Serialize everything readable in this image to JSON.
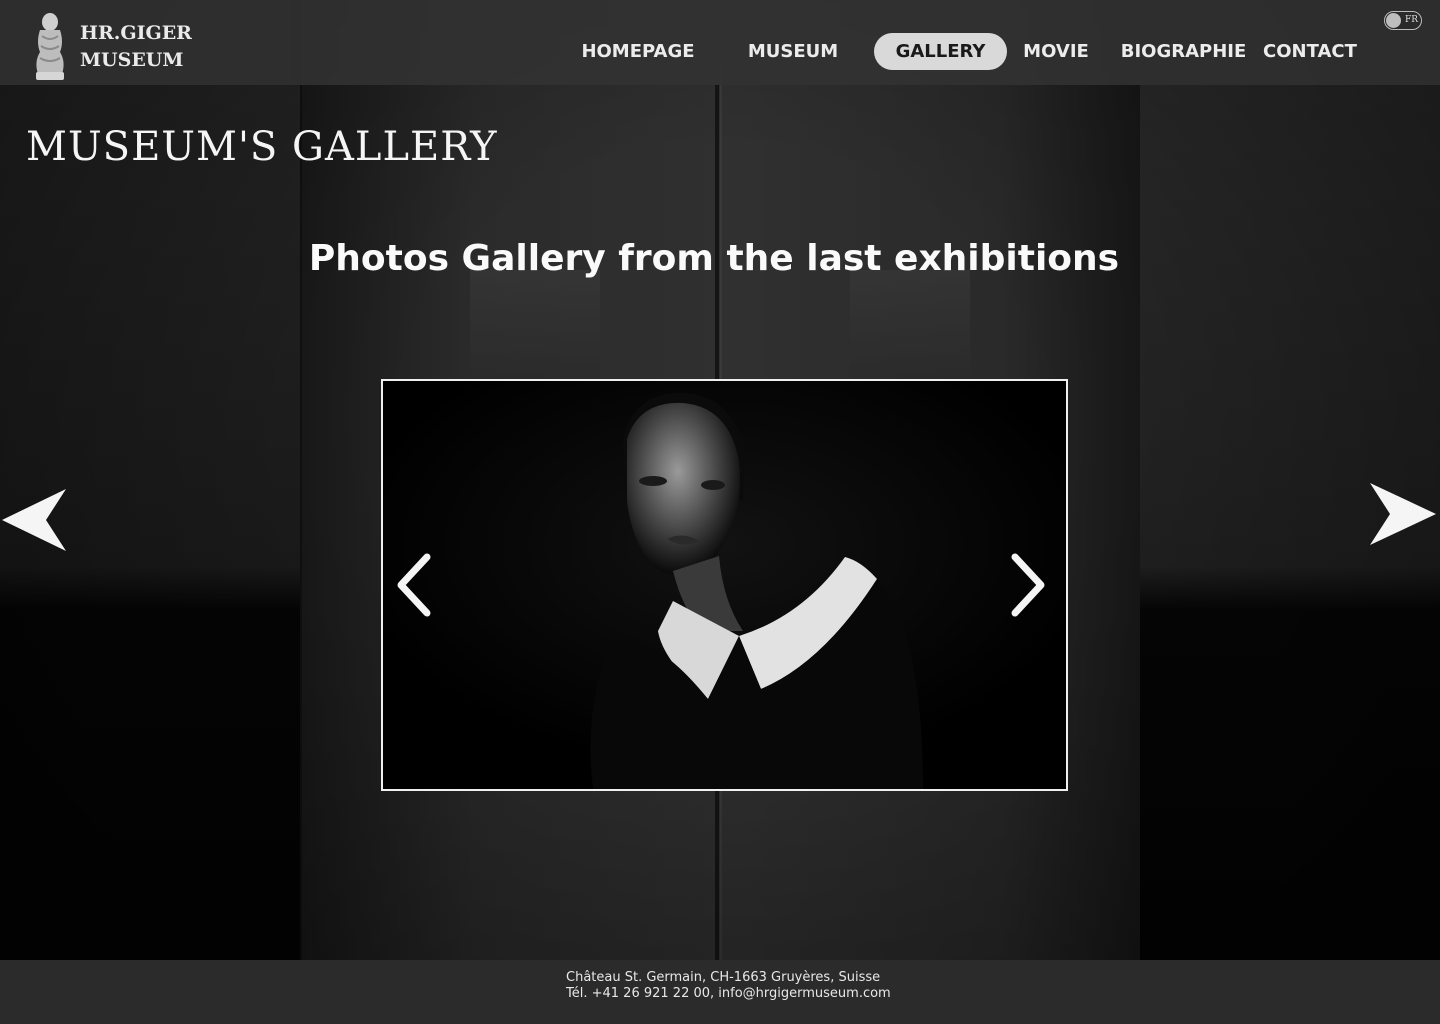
{
  "brand": {
    "line1": "HR.GIGER",
    "line2": "MUSEUM",
    "logo_icon": "statue-figure-icon"
  },
  "nav": {
    "items": [
      {
        "label": "HOMEPAGE",
        "active": false
      },
      {
        "label": "MUSEUM",
        "active": false
      },
      {
        "label": "GALLERY",
        "active": true
      },
      {
        "label": "MOVIE",
        "active": false
      },
      {
        "label": "BIOGRAPHIE",
        "active": false
      },
      {
        "label": "CONTACT",
        "active": false
      }
    ]
  },
  "language": {
    "label": "FR"
  },
  "page": {
    "title": "MUSEUM'S GALLERY",
    "subtitle": "Photos Gallery from the last exhibitions"
  },
  "gallery": {
    "prev_icon": "chevron-left-icon",
    "next_icon": "chevron-right-icon",
    "page_prev_icon": "arrow-left-icon",
    "page_next_icon": "arrow-right-icon"
  },
  "footer": {
    "address": "Château St. Germain, CH-1663 Gruyères, Suisse",
    "contact": "Tél. +41 26 921 22 00, info@hrgigermuseum.com"
  },
  "colors": {
    "header_bg": "#323232",
    "active_pill": "#d9d9d9",
    "footer_bg": "#2b2b2b",
    "text": "#ffffff"
  }
}
